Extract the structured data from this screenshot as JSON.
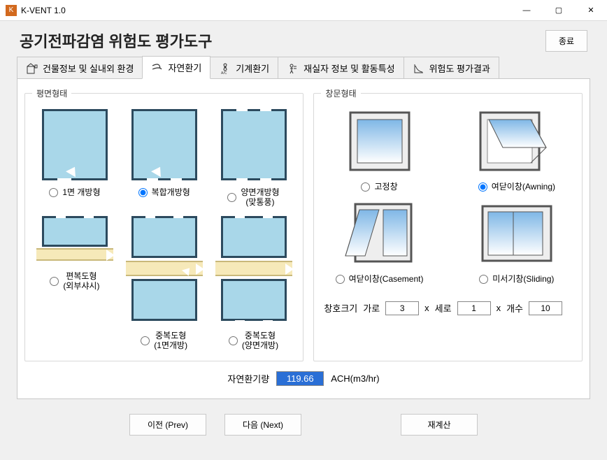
{
  "window": {
    "title": "K-VENT 1.0"
  },
  "header": {
    "title": "공기전파감염 위험도 평가도구",
    "exit_btn": "종료"
  },
  "tabs": [
    {
      "label": "건물정보 및 실내외 환경",
      "active": false
    },
    {
      "label": "자연환기",
      "active": true
    },
    {
      "label": "기계환기",
      "active": false
    },
    {
      "label": "재실자 정보 및 활동특성",
      "active": false
    },
    {
      "label": "위험도 평가결과",
      "active": false
    }
  ],
  "plan": {
    "legend": "평면형태",
    "options": [
      {
        "label": "1면 개방형",
        "checked": false
      },
      {
        "label": "복합개방형",
        "checked": true
      },
      {
        "label": "양면개방형\n(맞통풍)",
        "checked": false
      },
      {
        "label": "편복도형\n(외부샤시)",
        "checked": false
      },
      {
        "label": "중복도형\n(1면개방)",
        "checked": false
      },
      {
        "label": "중복도형\n(양면개방)",
        "checked": false
      }
    ]
  },
  "winform": {
    "legend": "창문형태",
    "options": [
      {
        "label": "고정창",
        "checked": false
      },
      {
        "label": "여닫이창(Awning)",
        "checked": true
      },
      {
        "label": "여닫이창(Casement)",
        "checked": false
      },
      {
        "label": "미서기창(Sliding)",
        "checked": false
      }
    ],
    "size": {
      "title": "창호크기",
      "width_label": "가로",
      "width_value": "3",
      "x1": "x",
      "height_label": "세로",
      "height_value": "1",
      "x2": "x",
      "count_label": "개수",
      "count_value": "10"
    }
  },
  "result": {
    "label": "자연환기량",
    "value": "119.66",
    "unit": "ACH(m3/hr)"
  },
  "footer": {
    "prev": "이전 (Prev)",
    "next": "다음 (Next)",
    "recalc": "재계산"
  }
}
